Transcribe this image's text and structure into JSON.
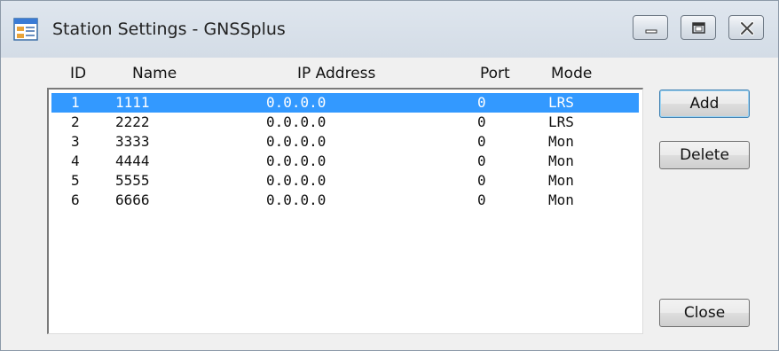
{
  "window": {
    "title": "Station Settings - GNSSplus"
  },
  "list": {
    "headers": {
      "id": "ID",
      "name": "Name",
      "ip": "IP Address",
      "port": "Port",
      "mode": "Mode"
    },
    "rows": [
      {
        "id": "1",
        "name": "1111",
        "ip": "0.0.0.0",
        "port": "0",
        "mode": "LRS",
        "selected": true
      },
      {
        "id": "2",
        "name": "2222",
        "ip": "0.0.0.0",
        "port": "0",
        "mode": "LRS",
        "selected": false
      },
      {
        "id": "3",
        "name": "3333",
        "ip": "0.0.0.0",
        "port": "0",
        "mode": "Mon",
        "selected": false
      },
      {
        "id": "4",
        "name": "4444",
        "ip": "0.0.0.0",
        "port": "0",
        "mode": "Mon",
        "selected": false
      },
      {
        "id": "5",
        "name": "5555",
        "ip": "0.0.0.0",
        "port": "0",
        "mode": "Mon",
        "selected": false
      },
      {
        "id": "6",
        "name": "6666",
        "ip": "0.0.0.0",
        "port": "0",
        "mode": "Mon",
        "selected": false
      }
    ]
  },
  "buttons": {
    "add": "Add",
    "delete": "Delete",
    "close": "Close"
  },
  "colors": {
    "selection": "#3399ff",
    "selection_text": "#ffffff"
  }
}
